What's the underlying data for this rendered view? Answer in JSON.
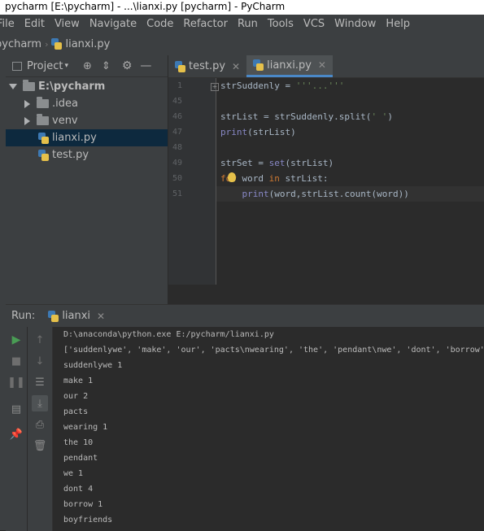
{
  "window": {
    "title": "pycharm [E:\\pycharm] - ...\\lianxi.py [pycharm] - PyCharm"
  },
  "menu": [
    "File",
    "Edit",
    "View",
    "Navigate",
    "Code",
    "Refactor",
    "Run",
    "Tools",
    "VCS",
    "Window",
    "Help"
  ],
  "navbar": {
    "project": "pycharm",
    "file": "lianxi.py"
  },
  "project_panel": {
    "title": "Project",
    "tree": [
      {
        "label": "E:\\pycharm",
        "kind": "root"
      },
      {
        "label": ".idea",
        "kind": "folder"
      },
      {
        "label": "venv",
        "kind": "folder"
      },
      {
        "label": "lianxi.py",
        "kind": "file",
        "selected": true
      },
      {
        "label": "test.py",
        "kind": "file"
      }
    ]
  },
  "editor": {
    "tabs": [
      {
        "label": "test.py"
      },
      {
        "label": "lianxi.py",
        "active": true
      }
    ],
    "lines": [
      {
        "num": "1",
        "code": "strSuddenly = '''...'''"
      },
      {
        "num": "45",
        "code": ""
      },
      {
        "num": "46",
        "code": "strList = strSuddenly.split(' ')"
      },
      {
        "num": "47",
        "code": "print(strList)"
      },
      {
        "num": "48",
        "code": ""
      },
      {
        "num": "49",
        "code": "strSet = set(strList)"
      },
      {
        "num": "50",
        "code": "for word in strList:"
      },
      {
        "num": "51",
        "code": "    print(word,strList.count(word))"
      }
    ]
  },
  "run_panel": {
    "label": "Run:",
    "tab": "lianxi",
    "output": [
      "D:\\anaconda\\python.exe E:/pycharm/lianxi.py",
      "['suddenlywe', 'make', 'our', 'pacts\\nwearing', 'the', 'pendant\\nwe', 'dont', 'borrow',",
      "suddenlywe 1",
      "make 1",
      "our 2",
      "pacts",
      "wearing 1",
      "the 10",
      "pendant",
      "we 1",
      "dont 4",
      "borrow 1",
      "boyfriends"
    ]
  },
  "colors": {
    "accent": "#4a88c7",
    "keyword": "#cc7832",
    "string": "#6a8759",
    "run_green": "#499c54"
  }
}
